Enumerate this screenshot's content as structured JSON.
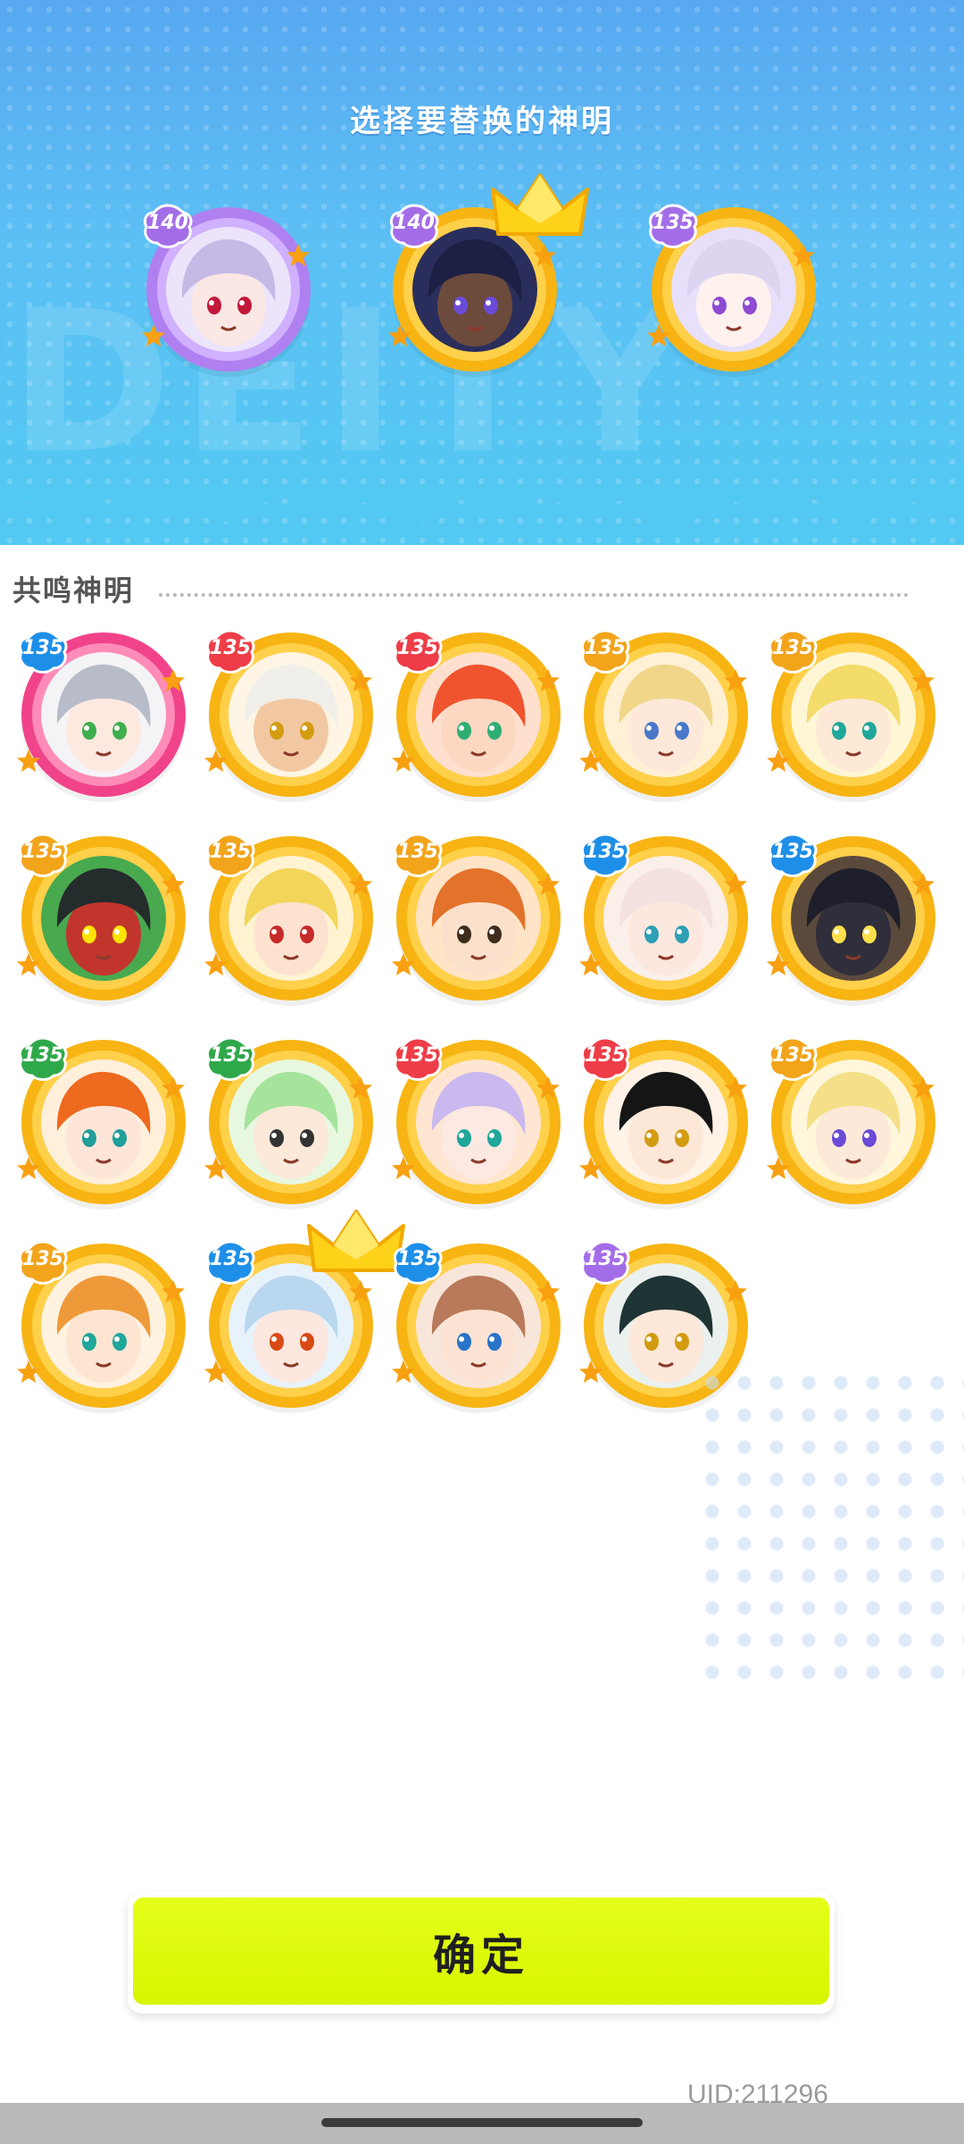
{
  "header": {
    "title": "选择要替换的神明"
  },
  "selected_deities": [
    {
      "level": "140",
      "ring": "purple",
      "badge_color": "#a46de8",
      "portrait": {
        "hair": "#c6b9e6",
        "skin": "#fbe7e4",
        "eye": "#c2183a",
        "bg": "#ece4fb"
      },
      "crown": false
    },
    {
      "level": "140",
      "ring": "gold",
      "badge_color": "#a46de8",
      "portrait": {
        "hair": "#1d1f44",
        "skin": "#6c4a3c",
        "eye": "#6a4bd8",
        "bg": "#2a2e5c"
      },
      "crown": true
    },
    {
      "level": "135",
      "ring": "gold",
      "badge_color": "#a46de8",
      "portrait": {
        "hair": "#ddd4f0",
        "skin": "#fff2ee",
        "eye": "#8e4ad3",
        "bg": "#e8e0fa"
      },
      "crown": false
    }
  ],
  "section": {
    "title": "共鸣神明"
  },
  "resonance_deities": [
    {
      "level": "135",
      "ring": "pink",
      "badge_color": "#1e8fe8",
      "portrait": {
        "hair": "#b8bcc8",
        "skin": "#fde9e0",
        "eye": "#3fae4d",
        "bg": "#f4f4f6"
      },
      "crown": false
    },
    {
      "level": "135",
      "ring": "gold",
      "badge_color": "#ee3d48",
      "portrait": {
        "hair": "#f1efea",
        "skin": "#f2c8a2",
        "eye": "#d39b10",
        "bg": "#fff5e4"
      },
      "crown": false
    },
    {
      "level": "135",
      "ring": "gold",
      "badge_color": "#ee3d48",
      "portrait": {
        "hair": "#f0542e",
        "skin": "#fcd7c2",
        "eye": "#2fae74",
        "bg": "#ffe0cf"
      },
      "crown": false
    },
    {
      "level": "135",
      "ring": "gold",
      "badge_color": "#f2a41b",
      "portrait": {
        "hair": "#f1d68a",
        "skin": "#fde8d9",
        "eye": "#4a78c8",
        "bg": "#fff0d6"
      },
      "crown": false
    },
    {
      "level": "135",
      "ring": "gold",
      "badge_color": "#f2a41b",
      "portrait": {
        "hair": "#f4dc6a",
        "skin": "#fde9d6",
        "eye": "#1fa79a",
        "bg": "#fff6d6"
      },
      "crown": false
    },
    {
      "level": "135",
      "ring": "gold",
      "badge_color": "#f2a41b",
      "portrait": {
        "hair": "#242c2c",
        "skin": "#c2352d",
        "eye": "#ffe400",
        "bg": "#48a94f"
      },
      "crown": false
    },
    {
      "level": "135",
      "ring": "gold",
      "badge_color": "#f2a41b",
      "portrait": {
        "hair": "#f3d55a",
        "skin": "#fde3cf",
        "eye": "#c62a2a",
        "bg": "#fff3d2"
      },
      "crown": false
    },
    {
      "level": "135",
      "ring": "gold",
      "badge_color": "#f2a41b",
      "portrait": {
        "hair": "#e3722a",
        "skin": "#fbe1cc",
        "eye": "#3e2c1c",
        "bg": "#ffe4c8"
      },
      "crown": false
    },
    {
      "level": "135",
      "ring": "gold",
      "badge_color": "#1e8fe8",
      "portrait": {
        "hair": "#f4e2e0",
        "skin": "#fde8e0",
        "eye": "#2e9fb4",
        "bg": "#fbefe9"
      },
      "crown": false
    },
    {
      "level": "135",
      "ring": "gold",
      "badge_color": "#1e8fe8",
      "portrait": {
        "hair": "#1e1f2a",
        "skin": "#2f2e3a",
        "eye": "#ffe04a",
        "bg": "#5b4a3c"
      },
      "crown": false
    },
    {
      "level": "135",
      "ring": "gold",
      "badge_color": "#2fa84b",
      "portrait": {
        "hair": "#ee6a1e",
        "skin": "#fde6d8",
        "eye": "#1f9e9a",
        "bg": "#fff0dc"
      },
      "crown": false
    },
    {
      "level": "135",
      "ring": "gold",
      "badge_color": "#2fa84b",
      "portrait": {
        "hair": "#a6e39c",
        "skin": "#fde9d9",
        "eye": "#333333",
        "bg": "#e8f8e0"
      },
      "crown": false
    },
    {
      "level": "135",
      "ring": "gold",
      "badge_color": "#ee3d48",
      "portrait": {
        "hair": "#c9b9ee",
        "skin": "#fde8e2",
        "eye": "#1fa79a",
        "bg": "#ffe6d2"
      },
      "crown": false
    },
    {
      "level": "135",
      "ring": "gold",
      "badge_color": "#ee3d48",
      "portrait": {
        "hair": "#151515",
        "skin": "#fde7d7",
        "eye": "#d39b10",
        "bg": "#fff2e6"
      },
      "crown": false
    },
    {
      "level": "135",
      "ring": "gold",
      "badge_color": "#f2a41b",
      "portrait": {
        "hair": "#f5e089",
        "skin": "#fde9d8",
        "eye": "#6a4bd8",
        "bg": "#fff6dc"
      },
      "crown": false
    },
    {
      "level": "135",
      "ring": "gold",
      "badge_color": "#f2a41b",
      "portrait": {
        "hair": "#ef9a3a",
        "skin": "#fde5d2",
        "eye": "#1fa79a",
        "bg": "#fff2e0"
      },
      "crown": false
    },
    {
      "level": "135",
      "ring": "gold",
      "badge_color": "#1e8fe8",
      "portrait": {
        "hair": "#b9d7ef",
        "skin": "#fde7df",
        "eye": "#d84a14",
        "bg": "#e8f2fb"
      },
      "crown": true
    },
    {
      "level": "135",
      "ring": "gold",
      "badge_color": "#1e8fe8",
      "portrait": {
        "hair": "#b87a5a",
        "skin": "#fde3d3",
        "eye": "#2a74c8",
        "bg": "#f9e6da"
      },
      "crown": false
    },
    {
      "level": "135",
      "ring": "gold",
      "badge_color": "#a46de8",
      "portrait": {
        "hair": "#1f3434",
        "skin": "#fde8d9",
        "eye": "#d39b10",
        "bg": "#eaf1ef"
      },
      "crown": false
    }
  ],
  "confirm_button": {
    "label": "确定"
  },
  "footer": {
    "uid": "UID:211296"
  }
}
